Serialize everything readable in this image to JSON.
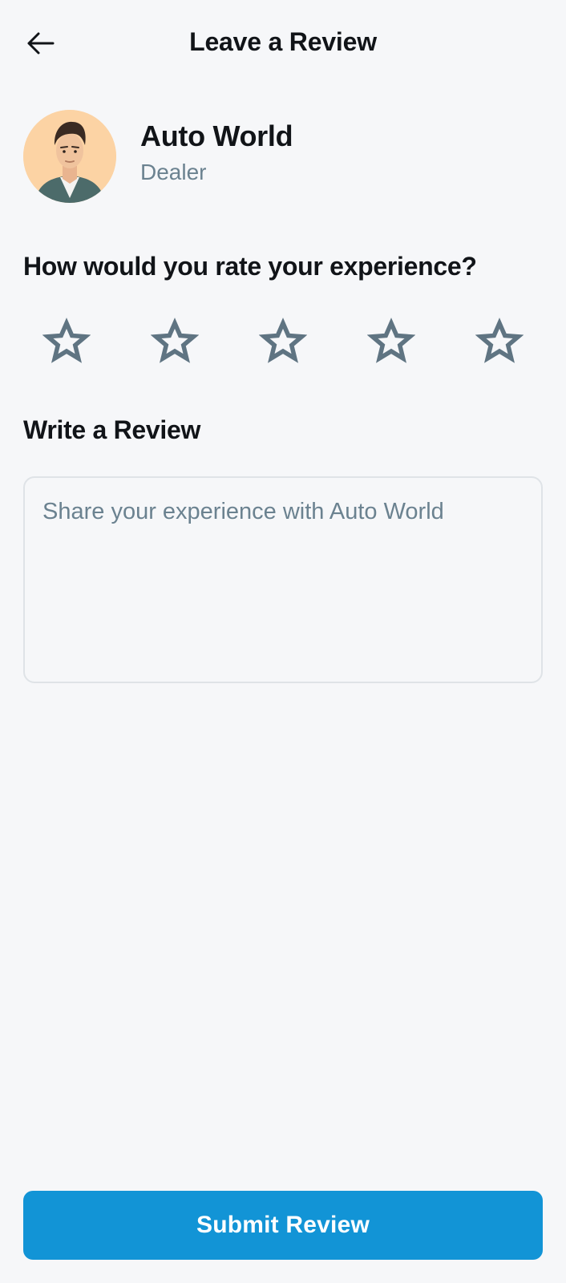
{
  "header": {
    "back_icon": "arrow-left-icon",
    "title": "Leave a Review"
  },
  "profile": {
    "name": "Auto World",
    "role": "Dealer",
    "avatar_bg": "#fcd3a4"
  },
  "rating": {
    "question": "How would you rate your experience?",
    "max_stars": 5,
    "selected": 0,
    "star_icon": "star-outline-icon",
    "star_color": "#5f7482"
  },
  "review": {
    "title": "Write a Review",
    "placeholder": "Share your experience with Auto World",
    "value": ""
  },
  "submit": {
    "label": "Submit Review",
    "color": "#1294d6"
  }
}
